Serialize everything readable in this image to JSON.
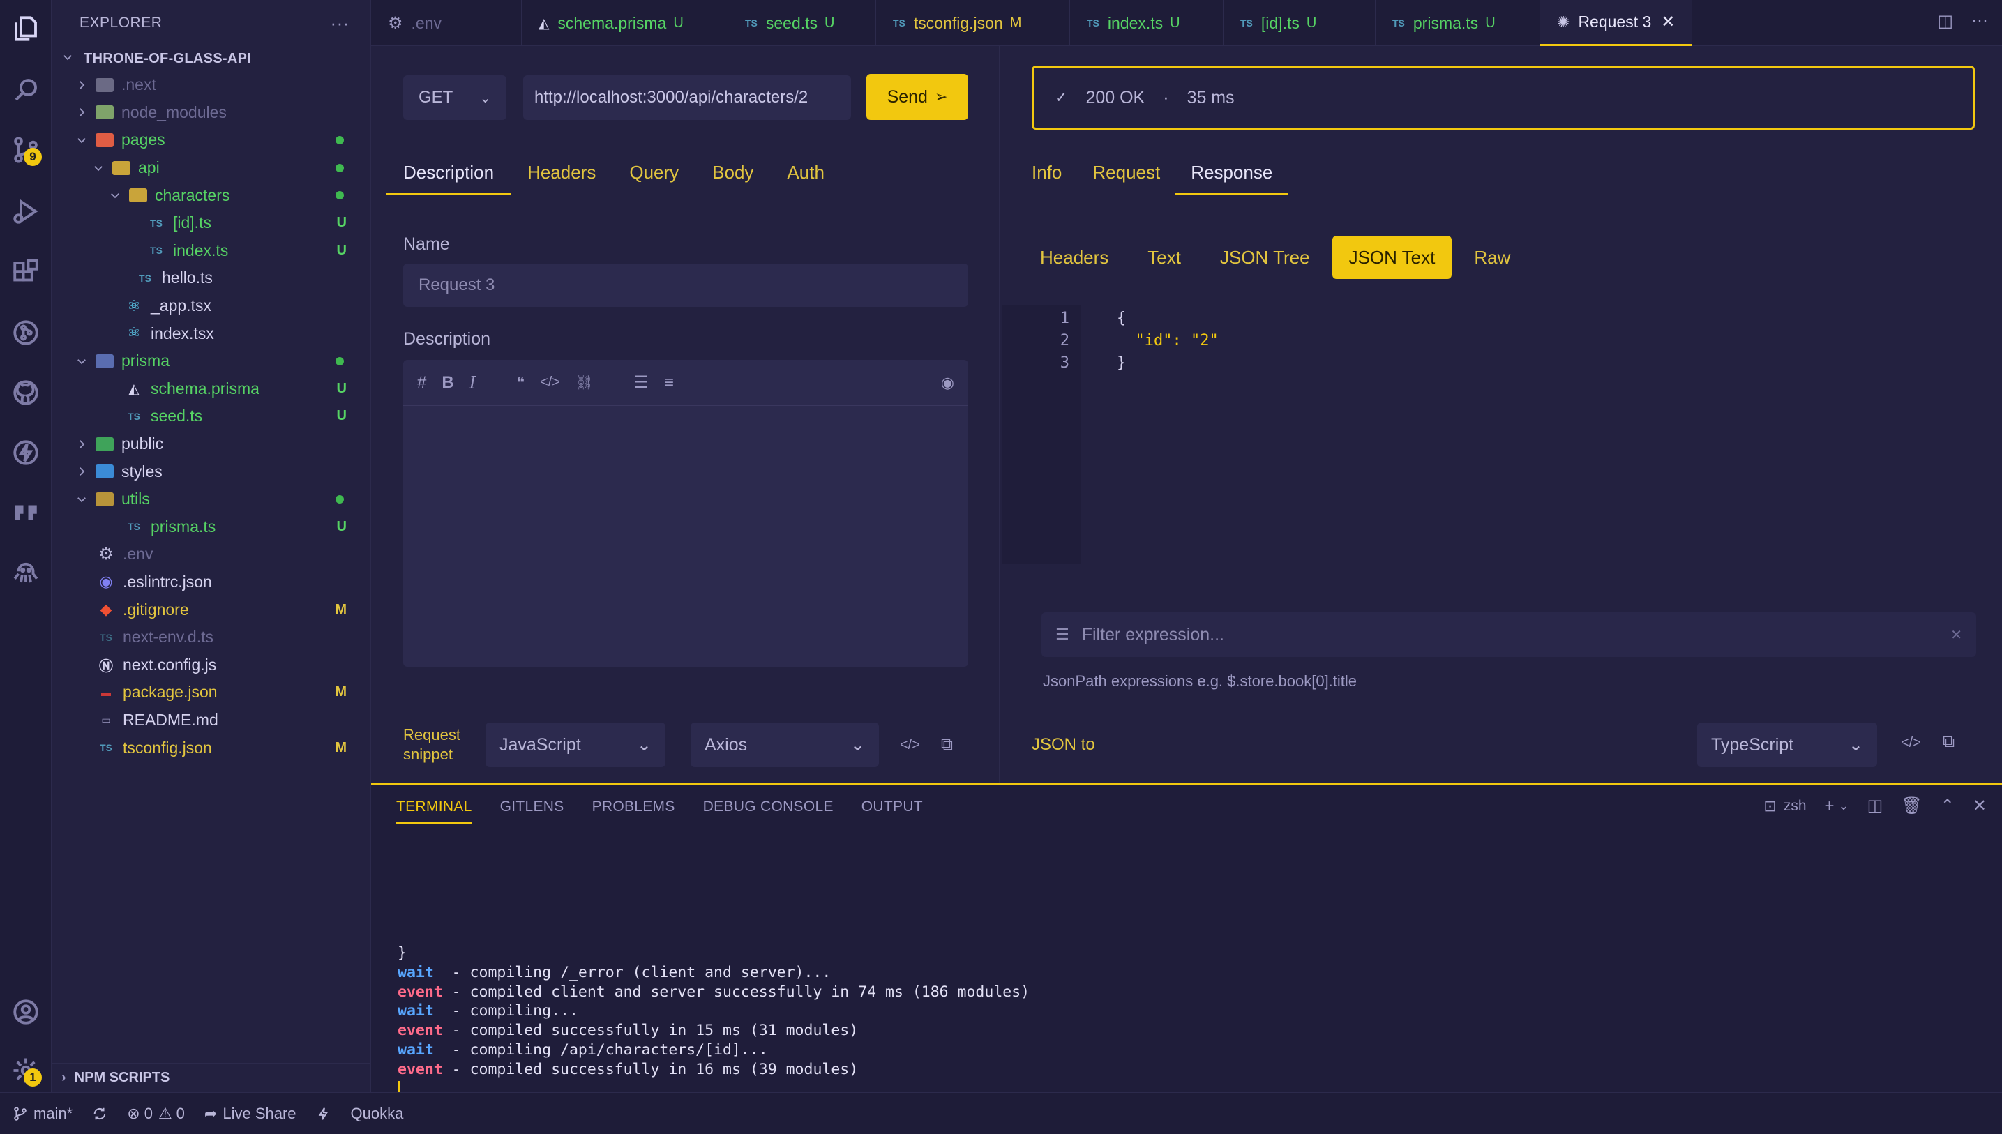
{
  "sidebar": {
    "title": "EXPLORER",
    "root": "THRONE-OF-GLASS-API",
    "npm": "NPM SCRIPTS",
    "items": [
      {
        "label": ".next",
        "status": ""
      },
      {
        "label": "node_modules",
        "status": ""
      },
      {
        "label": "pages",
        "status": ""
      },
      {
        "label": "api",
        "status": ""
      },
      {
        "label": "characters",
        "status": ""
      },
      {
        "label": "[id].ts",
        "status": "U"
      },
      {
        "label": "index.ts",
        "status": "U"
      },
      {
        "label": "hello.ts",
        "status": ""
      },
      {
        "label": "_app.tsx",
        "status": ""
      },
      {
        "label": "index.tsx",
        "status": ""
      },
      {
        "label": "prisma",
        "status": ""
      },
      {
        "label": "schema.prisma",
        "status": "U"
      },
      {
        "label": "seed.ts",
        "status": "U"
      },
      {
        "label": "public",
        "status": ""
      },
      {
        "label": "styles",
        "status": ""
      },
      {
        "label": "utils",
        "status": ""
      },
      {
        "label": "prisma.ts",
        "status": "U"
      },
      {
        "label": ".env",
        "status": ""
      },
      {
        "label": ".eslintrc.json",
        "status": ""
      },
      {
        "label": ".gitignore",
        "status": "M"
      },
      {
        "label": "next-env.d.ts",
        "status": ""
      },
      {
        "label": "next.config.js",
        "status": ""
      },
      {
        "label": "package.json",
        "status": "M"
      },
      {
        "label": "README.md",
        "status": ""
      },
      {
        "label": "tsconfig.json",
        "status": "M"
      }
    ]
  },
  "tabs": [
    {
      "label": ".env",
      "icon": "gear-icon",
      "mark": ""
    },
    {
      "label": "schema.prisma",
      "icon": "prisma-icon",
      "mark": "U"
    },
    {
      "label": "seed.ts",
      "icon": "TS",
      "mark": "U"
    },
    {
      "label": "tsconfig.json",
      "icon": "TS",
      "mark": "M"
    },
    {
      "label": "index.ts",
      "icon": "TS",
      "mark": "U"
    },
    {
      "label": "[id].ts",
      "icon": "TS",
      "mark": "U"
    },
    {
      "label": "prisma.ts",
      "icon": "TS",
      "mark": "U"
    },
    {
      "label": "Request 3",
      "icon": "thunder-client-icon",
      "mark": ""
    }
  ],
  "badges": {
    "source_control": "9",
    "settings": "1"
  },
  "request": {
    "method": "GET",
    "url": "http://localhost:3000/api/characters/2",
    "send": "Send",
    "tabs": [
      "Description",
      "Headers",
      "Query",
      "Body",
      "Auth"
    ],
    "name_label": "Name",
    "name_value": "Request 3",
    "desc_label": "Description",
    "snippet_label_1": "Request",
    "snippet_label_2": "snippet",
    "language": "JavaScript",
    "library": "Axios"
  },
  "response": {
    "status": "200 OK",
    "time": "35 ms",
    "tabs": [
      "Info",
      "Request",
      "Response"
    ],
    "view_tabs": [
      "Headers",
      "Text",
      "JSON Tree",
      "JSON Text",
      "Raw"
    ],
    "lines": [
      {
        "n": "1",
        "text": "{"
      },
      {
        "n": "2",
        "text": "  \"id\": \"2\""
      },
      {
        "n": "3",
        "text": "}"
      }
    ],
    "filter_placeholder": "Filter expression...",
    "hint": "JsonPath expressions e.g. $.store.book[0].title",
    "json_to_label": "JSON to",
    "json_to_lang": "TypeScript"
  },
  "terminal": {
    "tabs": [
      "TERMINAL",
      "GITLENS",
      "PROBLEMS",
      "DEBUG CONSOLE",
      "OUTPUT"
    ],
    "shell": "zsh",
    "lines": [
      {
        "tag": "",
        "text": "}"
      },
      {
        "tag": "wait",
        "text": "  - compiling /_error (client and server)..."
      },
      {
        "tag": "event",
        "text": " - compiled client and server successfully in 74 ms (186 modules)"
      },
      {
        "tag": "wait",
        "text": "  - compiling..."
      },
      {
        "tag": "event",
        "text": " - compiled successfully in 15 ms (31 modules)"
      },
      {
        "tag": "wait",
        "text": "  - compiling /api/characters/[id]..."
      },
      {
        "tag": "event",
        "text": " - compiled successfully in 16 ms (39 modules)"
      }
    ]
  },
  "statusbar": {
    "branch": "main*",
    "errors": "0",
    "warnings": "0",
    "live_share": "Live Share",
    "quokka": "Quokka"
  }
}
